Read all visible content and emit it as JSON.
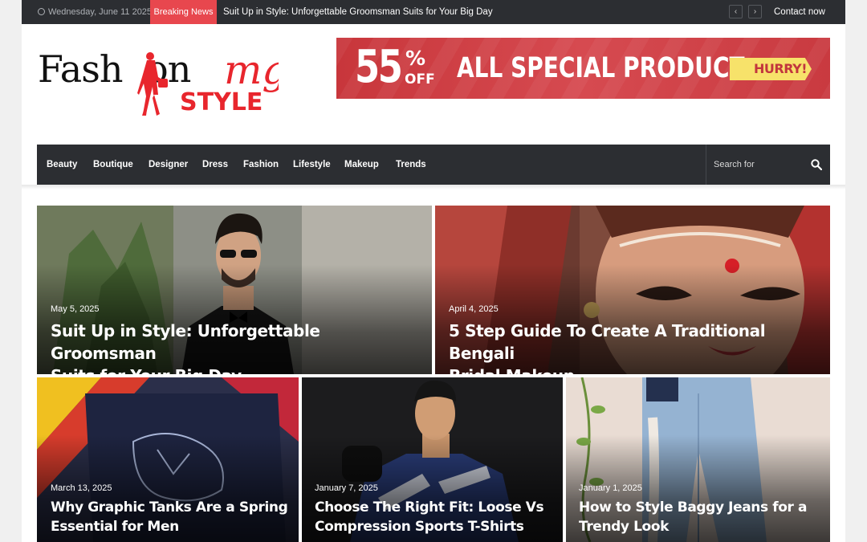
{
  "topbar": {
    "date": "Wednesday, June 11 2025",
    "breaking_label": "Breaking News",
    "ticker_text": "Suit Up in Style: Unforgettable Groomsman Suits for Your Big Day",
    "prev_icon": "chevron-left-icon",
    "next_icon": "chevron-right-icon",
    "contact": "Contact now"
  },
  "logo": {
    "word": "Fash",
    "word2": "on",
    "script": "mg",
    "style": "STYLE",
    "color_dark": "#111111",
    "color_accent": "#e8262d"
  },
  "banner": {
    "number": "55",
    "percent": "%",
    "off": "OFF",
    "text": "ALL SPECIAL PRODUCT",
    "cta": "HURRY!"
  },
  "nav": {
    "items": [
      "Beauty",
      "Boutique",
      "Designer",
      "Dress",
      "Fashion",
      "Lifestyle",
      "Makeup",
      "Trends"
    ],
    "search_placeholder": "Search for",
    "search_icon": "search-icon"
  },
  "posts": [
    {
      "date": "May 5, 2025",
      "title_line1": "Suit Up in Style: Unforgettable Groomsman",
      "title_line2": "Suits for Your Big Day"
    },
    {
      "date": "April 4, 2025",
      "title_line1": "5 Step Guide To Create A Traditional Bengali",
      "title_line2": "Bridal Makeup"
    },
    {
      "date": "March 13, 2025",
      "title_line1": "Why Graphic Tanks Are a Spring",
      "title_line2": "Essential for Men"
    },
    {
      "date": "January 7, 2025",
      "title_line1": "Choose The Right Fit: Loose Vs",
      "title_line2": "Compression Sports T-Shirts"
    },
    {
      "date": "January 1, 2025",
      "title_line1": "How to Style Baggy Jeans for a",
      "title_line2": "Trendy Look"
    }
  ],
  "colors": {
    "topbar_bg": "#2c2e32",
    "breaking_bg": "#e8474e",
    "banner_bg": "#d1434a",
    "cta_bg": "#f7e26a"
  }
}
